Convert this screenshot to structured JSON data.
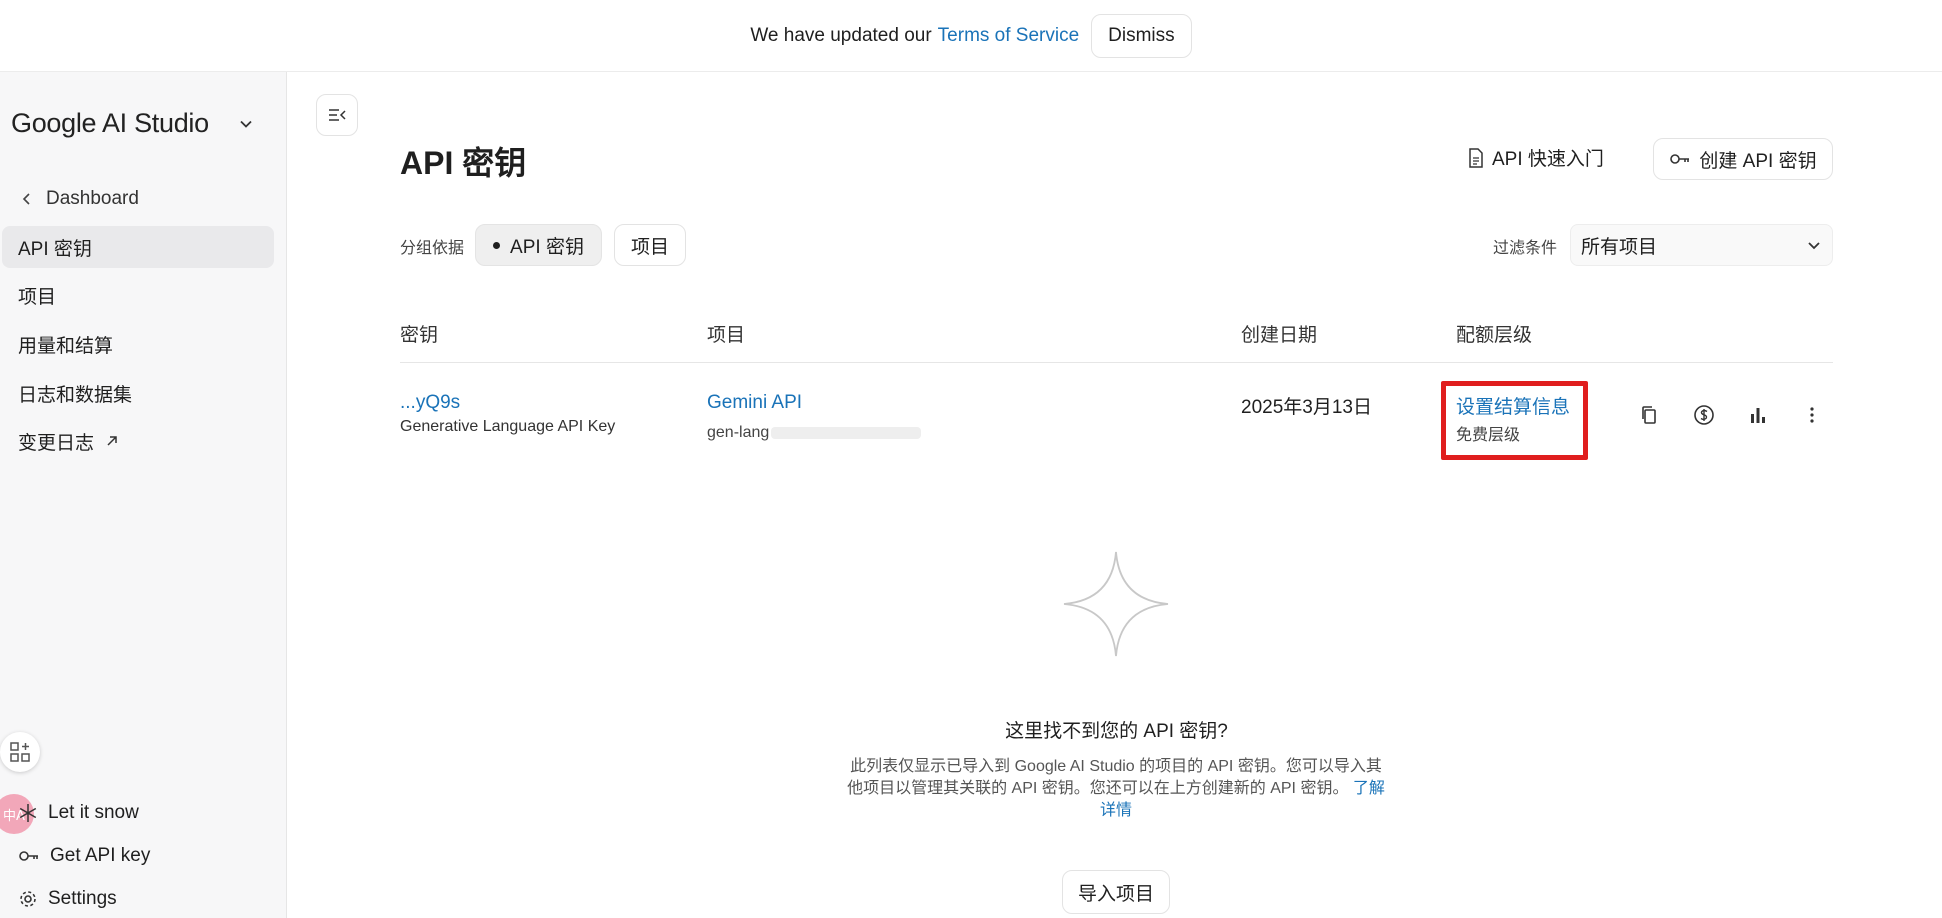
{
  "banner": {
    "text": "We have updated our",
    "link": "Terms of Service",
    "dismiss": "Dismiss"
  },
  "sidebar": {
    "brand": "Google AI Studio",
    "back": "Dashboard",
    "items": [
      {
        "label": "API 密钥",
        "active": true
      },
      {
        "label": "项目"
      },
      {
        "label": "用量和结算"
      },
      {
        "label": "日志和数据集"
      },
      {
        "label": "变更日志",
        "external": true
      }
    ],
    "bottom": [
      {
        "label": "Let it snow",
        "icon": "snowflake-icon"
      },
      {
        "label": "Get API key",
        "icon": "key-icon"
      },
      {
        "label": "Settings",
        "icon": "gear-icon"
      }
    ],
    "translate_badge": "中A"
  },
  "page": {
    "title": "API 密钥",
    "quickstart": "API 快速入门",
    "create_key": "创建 API 密钥",
    "group_by_label": "分组依据",
    "group_options": [
      "API 密钥",
      "项目"
    ],
    "filter_label": "过滤条件",
    "filter_value": "所有项目"
  },
  "table": {
    "headers": [
      "密钥",
      "项目",
      "创建日期",
      "配额层级"
    ],
    "rows": [
      {
        "key": "...yQ9s",
        "key_type": "Generative Language API Key",
        "project": "Gemini API",
        "project_id": "gen-lang",
        "created": "2025年3月13日",
        "quota_link": "设置结算信息",
        "quota_tier": "免费层级"
      }
    ]
  },
  "empty_state": {
    "title": "这里找不到您的 API 密钥?",
    "desc": "此列表仅显示已导入到 Google AI Studio 的项目的 API 密钥。您可以导入其他项目以管理其关联的 API 密钥。您还可以在上方创建新的 API 密钥。",
    "learn_more": "了解详情",
    "import": "导入项目"
  },
  "colors": {
    "link": "#1a73b8",
    "highlight": "#e01e1e",
    "sidebar_bg": "#f7f7f8"
  }
}
